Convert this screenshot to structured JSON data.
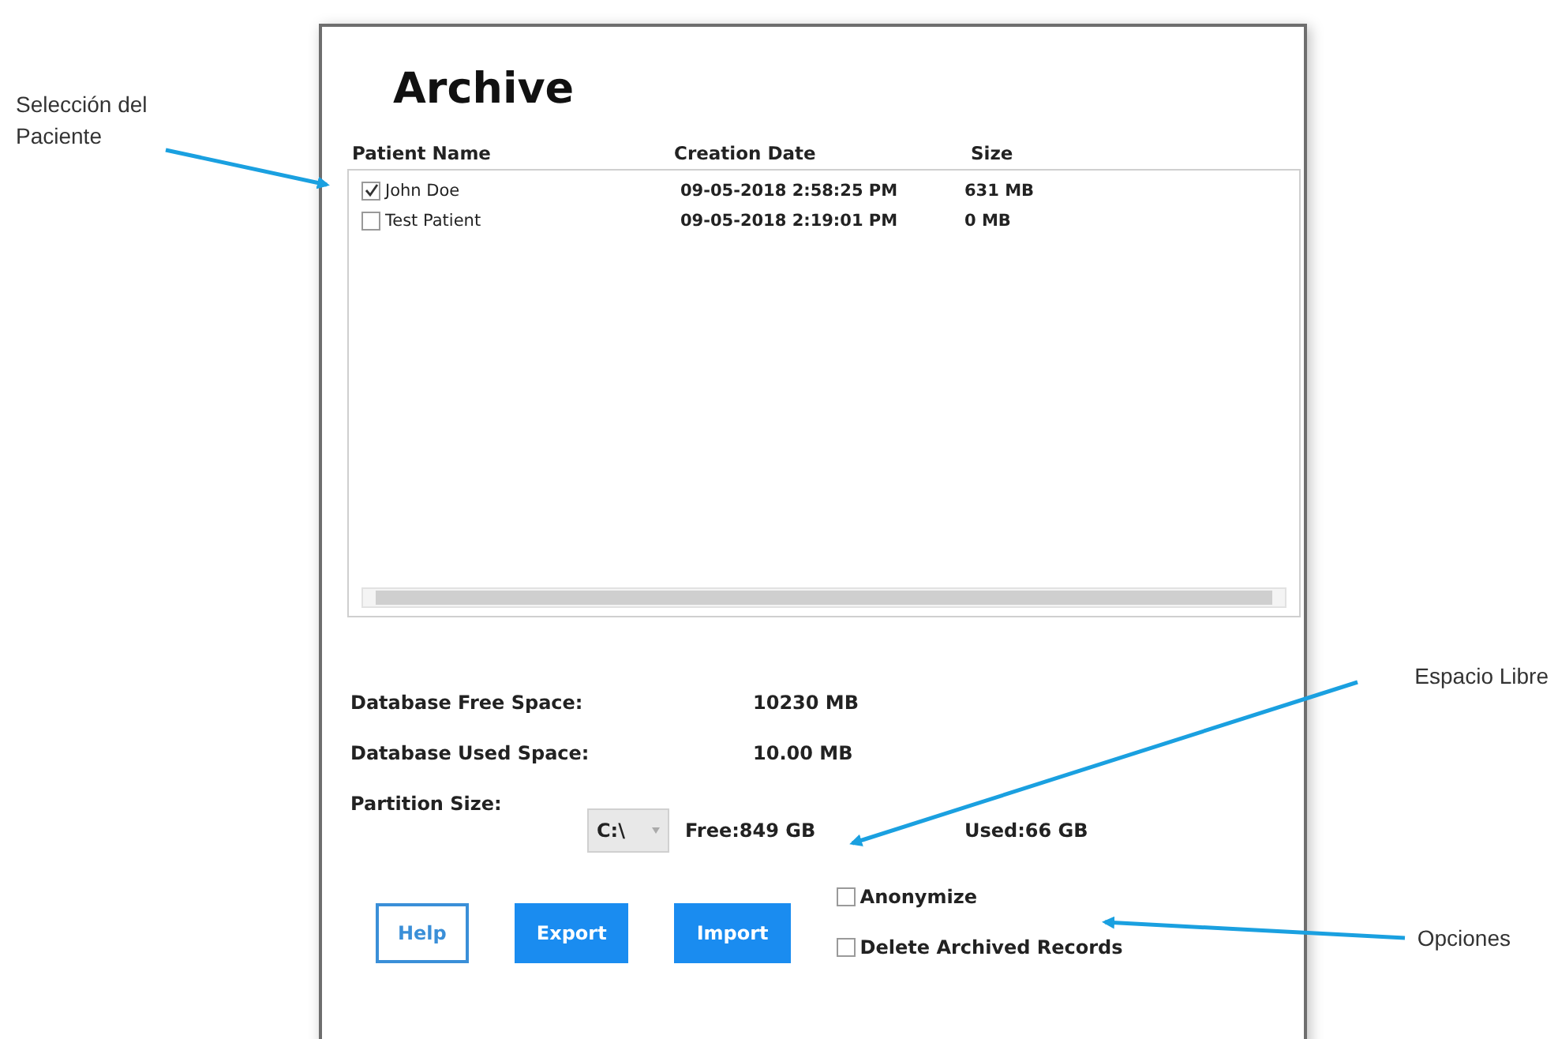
{
  "panel": {
    "title": "Archive"
  },
  "table": {
    "columns": [
      "Patient Name",
      "Creation Date",
      "Size"
    ],
    "rows": [
      {
        "name": "John Doe",
        "checked": true,
        "creation_date": "09-05-2018 2:58:25 PM",
        "size": "631 MB"
      },
      {
        "name": "Test Patient",
        "checked": false,
        "creation_date": "09-05-2018 2:19:01 PM",
        "size": "0 MB"
      }
    ]
  },
  "stats": [
    {
      "label": "Database Free Space:",
      "value": "10230 MB"
    },
    {
      "label": "Database Used Space:",
      "value": "10.00 MB"
    }
  ],
  "partition": {
    "label": "Partition Size:",
    "drive": "C:\\",
    "free": "Free:849 GB",
    "used": "Used:66 GB"
  },
  "buttons": [
    {
      "label": "Help",
      "kind": "outline"
    },
    {
      "label": "Export",
      "kind": "primary"
    },
    {
      "label": "Import",
      "kind": "primary"
    }
  ],
  "options": [
    {
      "label": "Anonymize",
      "checked": false
    },
    {
      "label": "Delete Archived Records",
      "checked": false
    }
  ],
  "annotations": [
    {
      "text": "Selección del Paciente"
    },
    {
      "text": "Espacio Libre"
    },
    {
      "text": "Opciones"
    }
  ]
}
